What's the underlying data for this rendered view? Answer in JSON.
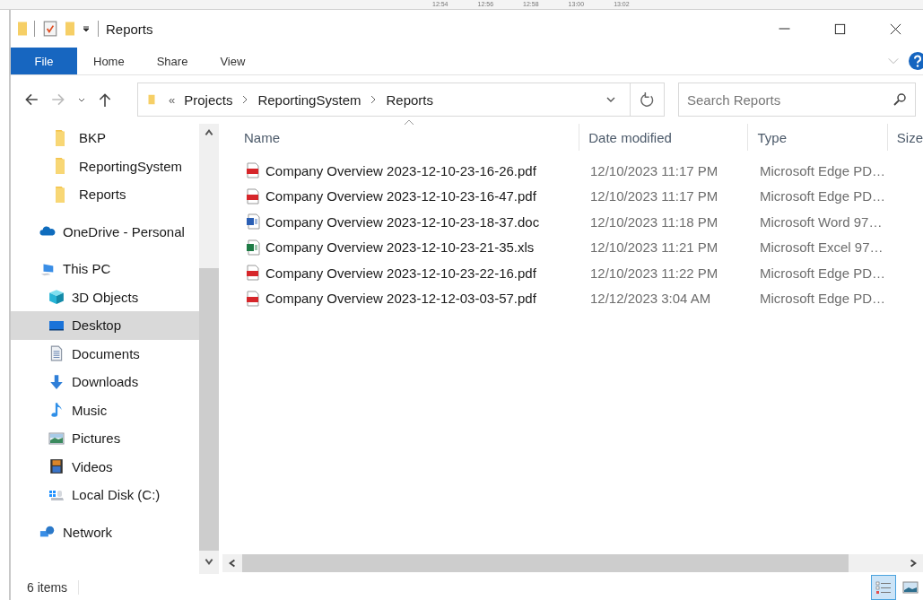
{
  "background_times": [
    "12:54",
    "12:56",
    "12:58",
    "13:00",
    "13:02"
  ],
  "window": {
    "title": "Reports"
  },
  "ribbon_tabs": [
    {
      "label": "File",
      "selected": true
    },
    {
      "label": "Home",
      "selected": false
    },
    {
      "label": "Share",
      "selected": false
    },
    {
      "label": "View",
      "selected": false
    }
  ],
  "address_bar": {
    "overflow": "«",
    "path": [
      "Projects",
      "ReportingSystem",
      "Reports"
    ]
  },
  "search": {
    "placeholder": "Search Reports"
  },
  "sidebar": {
    "pinned": [
      {
        "label": "BKP",
        "kind": "folder",
        "selected": false
      },
      {
        "label": "ReportingSystem",
        "kind": "folder",
        "selected": false
      },
      {
        "label": "Reports",
        "kind": "folder",
        "selected": false
      }
    ],
    "items": [
      {
        "label": "OneDrive - Personal",
        "kind": "cloud",
        "selected": false
      },
      {
        "label": "This PC",
        "kind": "pc",
        "selected": false,
        "children": [
          {
            "label": "3D Objects",
            "kind": "cube",
            "selected": false
          },
          {
            "label": "Desktop",
            "kind": "desktop",
            "selected": true
          },
          {
            "label": "Documents",
            "kind": "documents",
            "selected": false
          },
          {
            "label": "Downloads",
            "kind": "downloads",
            "selected": false
          },
          {
            "label": "Music",
            "kind": "music",
            "selected": false
          },
          {
            "label": "Pictures",
            "kind": "pictures",
            "selected": false
          },
          {
            "label": "Videos",
            "kind": "videos",
            "selected": false
          },
          {
            "label": "Local Disk (C:)",
            "kind": "disk",
            "selected": false
          }
        ]
      },
      {
        "label": "Network",
        "kind": "network",
        "selected": false
      }
    ]
  },
  "table": {
    "columns": [
      "Name",
      "Date modified",
      "Type",
      "Size"
    ],
    "rows": [
      {
        "kind": "pdf",
        "name": "Company Overview 2023-12-10-23-16-26.pdf",
        "date": "12/10/2023 11:17 PM",
        "type": "Microsoft Edge PD…"
      },
      {
        "kind": "pdf",
        "name": "Company Overview 2023-12-10-23-16-47.pdf",
        "date": "12/10/2023 11:17 PM",
        "type": "Microsoft Edge PD…"
      },
      {
        "kind": "word",
        "name": "Company Overview 2023-12-10-23-18-37.doc",
        "date": "12/10/2023 11:18 PM",
        "type": "Microsoft Word 97…"
      },
      {
        "kind": "excel",
        "name": "Company Overview 2023-12-10-23-21-35.xls",
        "date": "12/10/2023 11:21 PM",
        "type": "Microsoft Excel 97…"
      },
      {
        "kind": "pdf",
        "name": "Company Overview 2023-12-10-23-22-16.pdf",
        "date": "12/10/2023 11:22 PM",
        "type": "Microsoft Edge PD…"
      },
      {
        "kind": "pdf",
        "name": "Company Overview 2023-12-12-03-03-57.pdf",
        "date": "12/12/2023 3:04 AM",
        "type": "Microsoft Edge PD…"
      }
    ]
  },
  "status_bar": {
    "count": "6 items",
    "view_modes": [
      {
        "kind": "details",
        "selected": true
      },
      {
        "kind": "thumbnails",
        "selected": false
      }
    ]
  }
}
